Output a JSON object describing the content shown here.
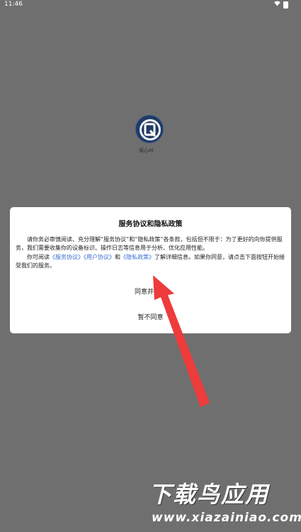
{
  "status_bar": {
    "time": "11:46"
  },
  "app": {
    "name": "省心AI",
    "logo_color": "#1f3a66"
  },
  "dialog": {
    "title": "服务协议和隐私政策",
    "paragraph1": "请你务必审慎阅读、充分理解“服务协议”和“隐私政策”各条款，包括但不限于：为了更好的向你提供服务，我们需要收集你的设备标识、操作日志等信息用于分析、优化应用性能。",
    "p2_prefix": "你可阅读",
    "link_service": "《服务协议》",
    "link_user": "《用户协议》",
    "p2_and": "和",
    "link_privacy": "《隐私政策》",
    "p2_suffix": "了解详细信息。如果你同意，请点击下面按钮开始接受我们的服务。",
    "accept_label": "同意并接受",
    "decline_label": "暂不同意",
    "link_color": "#3b6fd2"
  },
  "overlay": {
    "arrow_color": "#ee3b3b"
  },
  "watermark": {
    "logo_text": "下载鸟应用",
    "url": "www.xiazainiao.com"
  }
}
